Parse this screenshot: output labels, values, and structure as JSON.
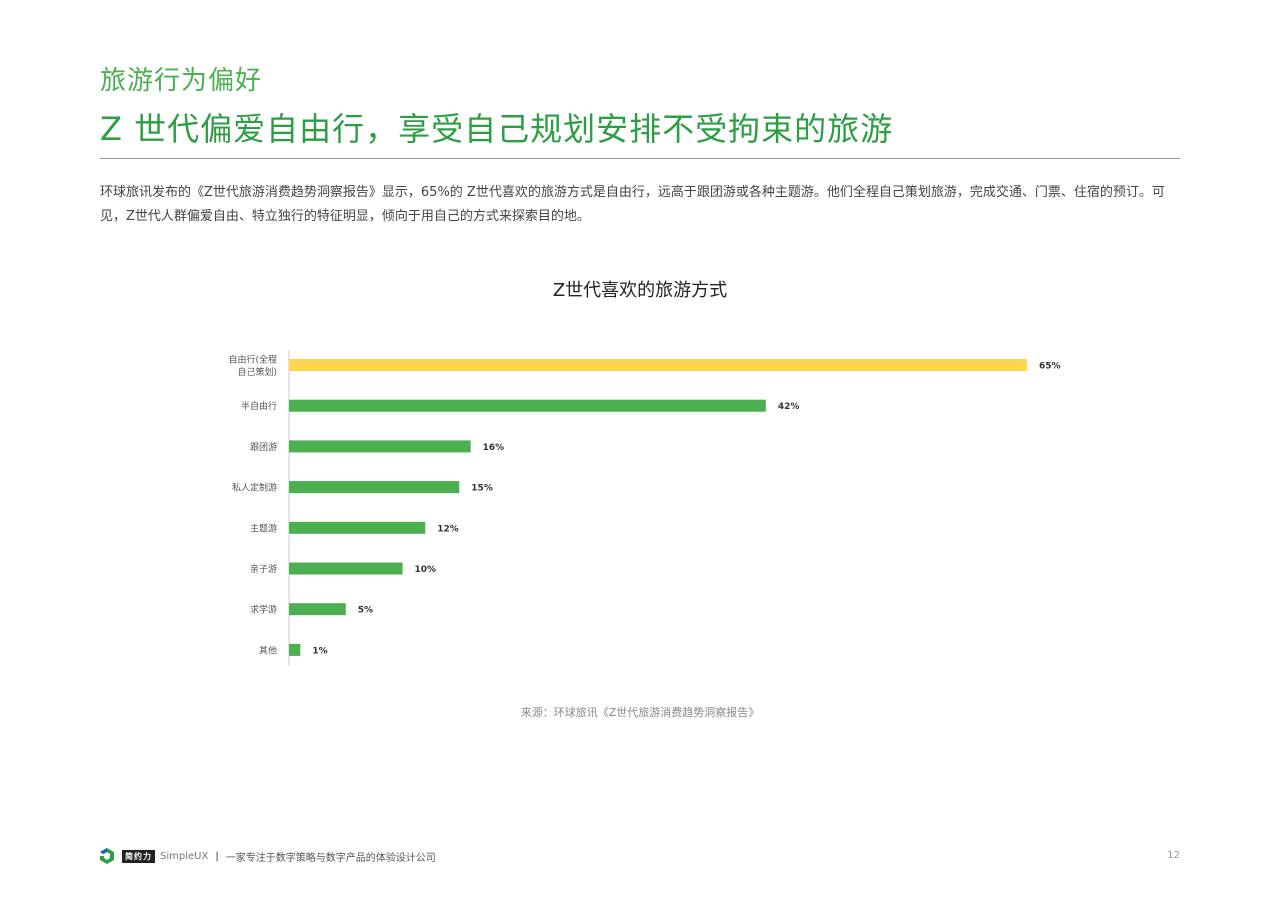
{
  "header": {
    "section_label": "旅游行为偏好",
    "headline": "Z 世代偏爱自由行，享受自己规划安排不受拘束的旅游"
  },
  "body": {
    "paragraph": "环球旅讯发布的《Z世代旅游消费趋势洞察报告》显示，65%的 Z世代喜欢的旅游方式是自由行，远高于跟团游或各种主题游。他们全程自己策划旅游，完成交通、门票、住宿的预订。可见，Z世代人群偏爱自由、特立独行的特征明显，倾向于用自己的方式来探索目的地。"
  },
  "chart_data": {
    "type": "bar",
    "orientation": "horizontal",
    "title": "Z世代喜欢的旅游方式",
    "categories": [
      "自由行(全程自己策划)",
      "半自由行",
      "跟团游",
      "私人定制游",
      "主题游",
      "亲子游",
      "求学游",
      "其他"
    ],
    "category_lines": [
      [
        "自由行(全程",
        "自己策划)"
      ],
      [
        "半自由行"
      ],
      [
        "跟团游"
      ],
      [
        "私人定制游"
      ],
      [
        "主题游"
      ],
      [
        "亲子游"
      ],
      [
        "求学游"
      ],
      [
        "其他"
      ]
    ],
    "values": [
      65,
      42,
      16,
      15,
      12,
      10,
      5,
      1
    ],
    "value_labels": [
      "65%",
      "42%",
      "16%",
      "15%",
      "12%",
      "10%",
      "5%",
      "1%"
    ],
    "unit": "%",
    "highlight_index": 0,
    "colors": {
      "highlight": "#ffd54f",
      "default": "#4caf50"
    },
    "xlim": [
      0,
      65
    ],
    "grid": false,
    "legend": "none",
    "source": "来源：环球旅讯《Z世代旅游消费趋势洞察报告》"
  },
  "footer": {
    "logo_wordmark": "简约力",
    "brand": "SimpleUX",
    "separator": "|",
    "tagline": "一家专注于数字策略与数字产品的体验设计公司",
    "page_number": "12"
  },
  "theme": {
    "accent": "#4caf50",
    "headline_color": "#2e9e45"
  },
  "icons": {
    "logo": "simpleux-logo-icon"
  }
}
